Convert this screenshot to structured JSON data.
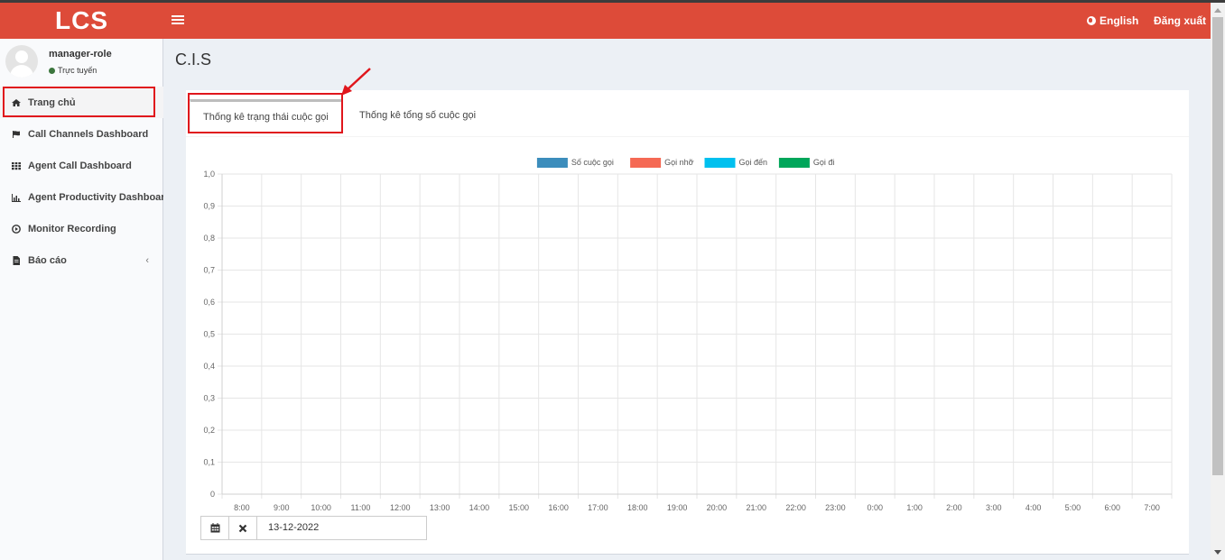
{
  "header": {
    "logo": "LCS",
    "language": "English",
    "logout": "Đăng xuất"
  },
  "user": {
    "name": "manager-role",
    "status": "Trực tuyến"
  },
  "sidebar": {
    "items": [
      {
        "label": "Trang chủ",
        "icon": "home-icon"
      },
      {
        "label": "Call Channels Dashboard",
        "icon": "flag-icon"
      },
      {
        "label": "Agent Call Dashboard",
        "icon": "grid-icon"
      },
      {
        "label": "Agent Productivity Dashboard",
        "icon": "bar-chart-icon"
      },
      {
        "label": "Monitor Recording",
        "icon": "play-circle-icon"
      },
      {
        "label": "Báo cáo",
        "icon": "file-icon"
      }
    ]
  },
  "page": {
    "title": "C.I.S"
  },
  "tabs": [
    {
      "label": "Thống kê trạng thái cuộc gọi"
    },
    {
      "label": "Thống kê tổng số cuộc gọi"
    }
  ],
  "date": {
    "value": "13-12-2022"
  },
  "chart_data": {
    "type": "bar",
    "categories": [
      "8:00",
      "9:00",
      "10:00",
      "11:00",
      "12:00",
      "13:00",
      "14:00",
      "15:00",
      "16:00",
      "17:00",
      "18:00",
      "19:00",
      "20:00",
      "21:00",
      "22:00",
      "23:00",
      "0:00",
      "1:00",
      "2:00",
      "3:00",
      "4:00",
      "5:00",
      "6:00",
      "7:00"
    ],
    "series": [
      {
        "name": "Số cuộc gọi",
        "color": "#3c8dbc",
        "values": [
          0,
          0,
          0,
          0,
          0,
          0,
          0,
          0,
          0,
          0,
          0,
          0,
          0,
          0,
          0,
          0,
          0,
          0,
          0,
          0,
          0,
          0,
          0,
          0
        ]
      },
      {
        "name": "Gọi nhỡ",
        "color": "#f56954",
        "values": [
          0,
          0,
          0,
          0,
          0,
          0,
          0,
          0,
          0,
          0,
          0,
          0,
          0,
          0,
          0,
          0,
          0,
          0,
          0,
          0,
          0,
          0,
          0,
          0
        ]
      },
      {
        "name": "Gọi đến",
        "color": "#00c0ef",
        "values": [
          0,
          0,
          0,
          0,
          0,
          0,
          0,
          0,
          0,
          0,
          0,
          0,
          0,
          0,
          0,
          0,
          0,
          0,
          0,
          0,
          0,
          0,
          0,
          0
        ]
      },
      {
        "name": "Gọi đi",
        "color": "#00a65a",
        "values": [
          0,
          0,
          0,
          0,
          0,
          0,
          0,
          0,
          0,
          0,
          0,
          0,
          0,
          0,
          0,
          0,
          0,
          0,
          0,
          0,
          0,
          0,
          0,
          0
        ]
      }
    ],
    "yticks": [
      "0",
      "0,1",
      "0,2",
      "0,3",
      "0,4",
      "0,5",
      "0,6",
      "0,7",
      "0,8",
      "0,9",
      "1,0"
    ],
    "ylim": [
      0,
      1
    ],
    "grid": true,
    "legend": "top-center"
  }
}
